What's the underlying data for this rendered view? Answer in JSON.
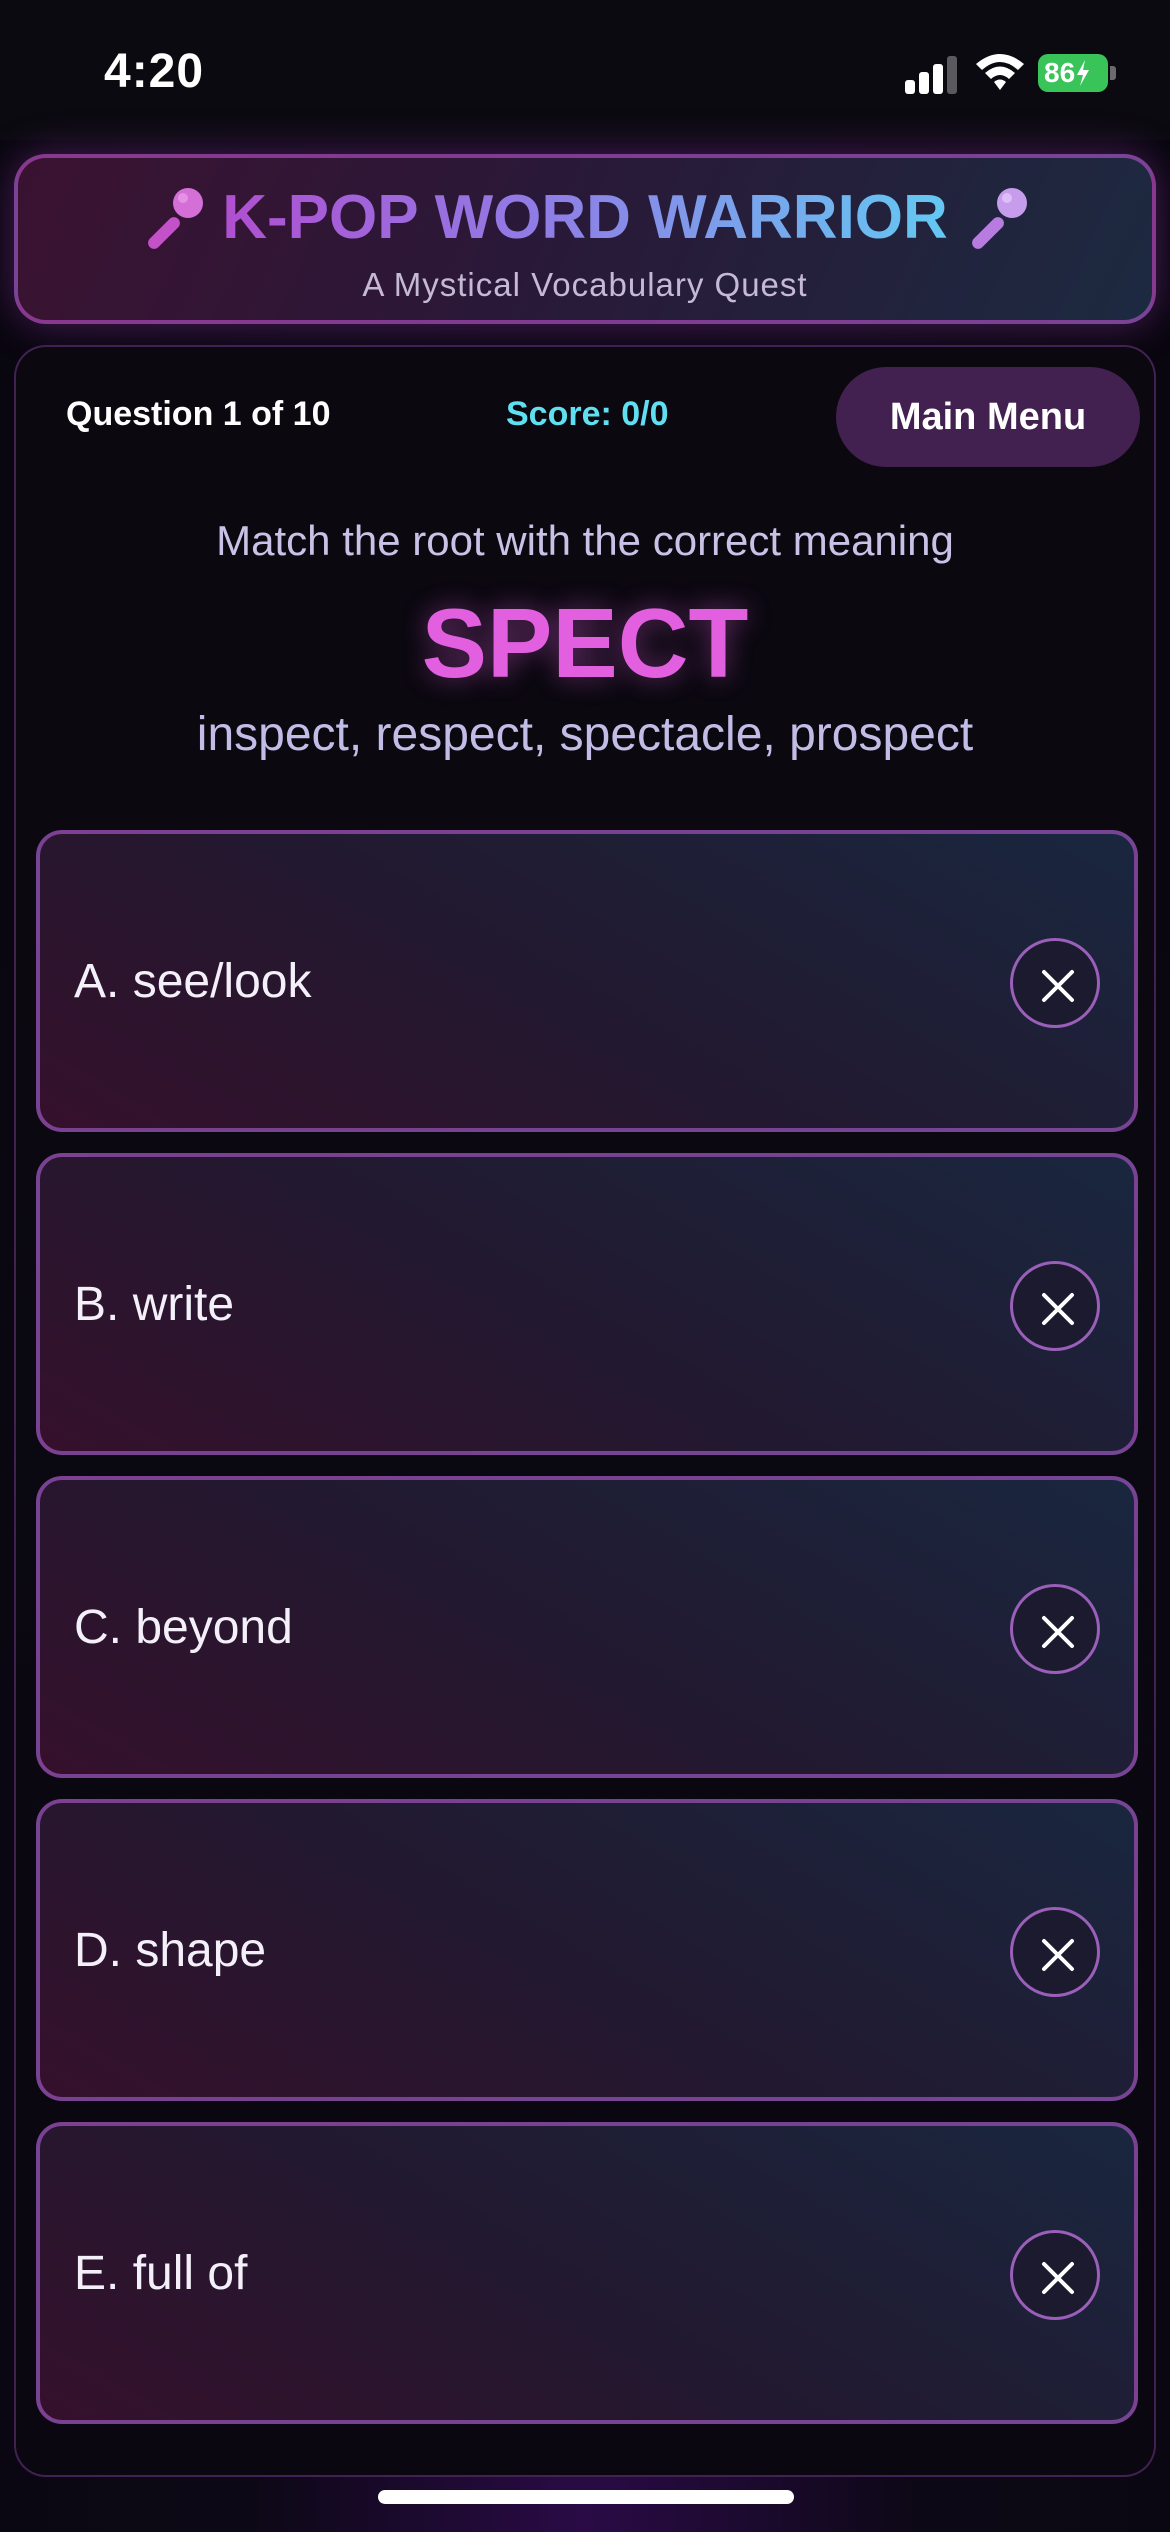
{
  "status_bar": {
    "time": "4:20",
    "battery": "86"
  },
  "header": {
    "title": "K-POP WORD WARRIOR",
    "subtitle": "A Mystical Vocabulary Quest",
    "icon_left": "microphone-icon",
    "icon_right": "microphone-icon"
  },
  "game": {
    "question_counter": "Question 1 of 10",
    "score": "Score: 0/0",
    "menu_label": "Main Menu",
    "prompt": "Match the root with the correct meaning",
    "root": "SPECT",
    "examples": "inspect, respect, spectacle, prospect"
  },
  "options": [
    {
      "label": "A. see/look"
    },
    {
      "label": "B. write"
    },
    {
      "label": "C. beyond"
    },
    {
      "label": "D. shape"
    },
    {
      "label": "E. full of"
    }
  ],
  "colors": {
    "root_word": "#e25fe0",
    "score": "#5fdff0",
    "menu_button": "#42204f",
    "option_border": "#9650b4"
  }
}
